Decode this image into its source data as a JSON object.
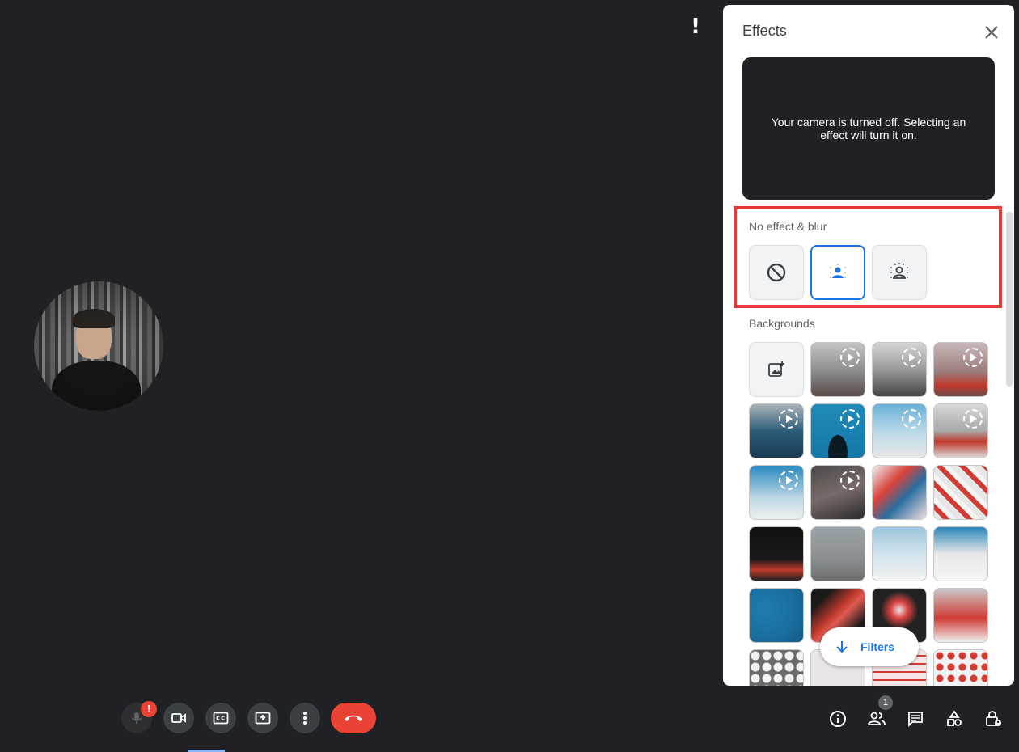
{
  "alert_glyph": "!",
  "effects_panel": {
    "title": "Effects",
    "preview_message": "Your camera is turned off. Selecting an effect will turn it on.",
    "blur_section_label": "No effect & blur",
    "blur_options": [
      {
        "name": "no-effect",
        "icon": "block-icon"
      },
      {
        "name": "slight-blur",
        "icon": "person-blur-icon",
        "selected": true
      },
      {
        "name": "blur",
        "icon": "person-blur-strong-icon"
      }
    ],
    "backgrounds_label": "Backgrounds",
    "filters_label": "Filters"
  },
  "controls": {
    "mic_badge": "!",
    "participants_count": "1"
  },
  "colors": {
    "accent": "#1a73e8",
    "end_call": "#ea4335",
    "highlight": "#e53935",
    "background": "#202124"
  }
}
